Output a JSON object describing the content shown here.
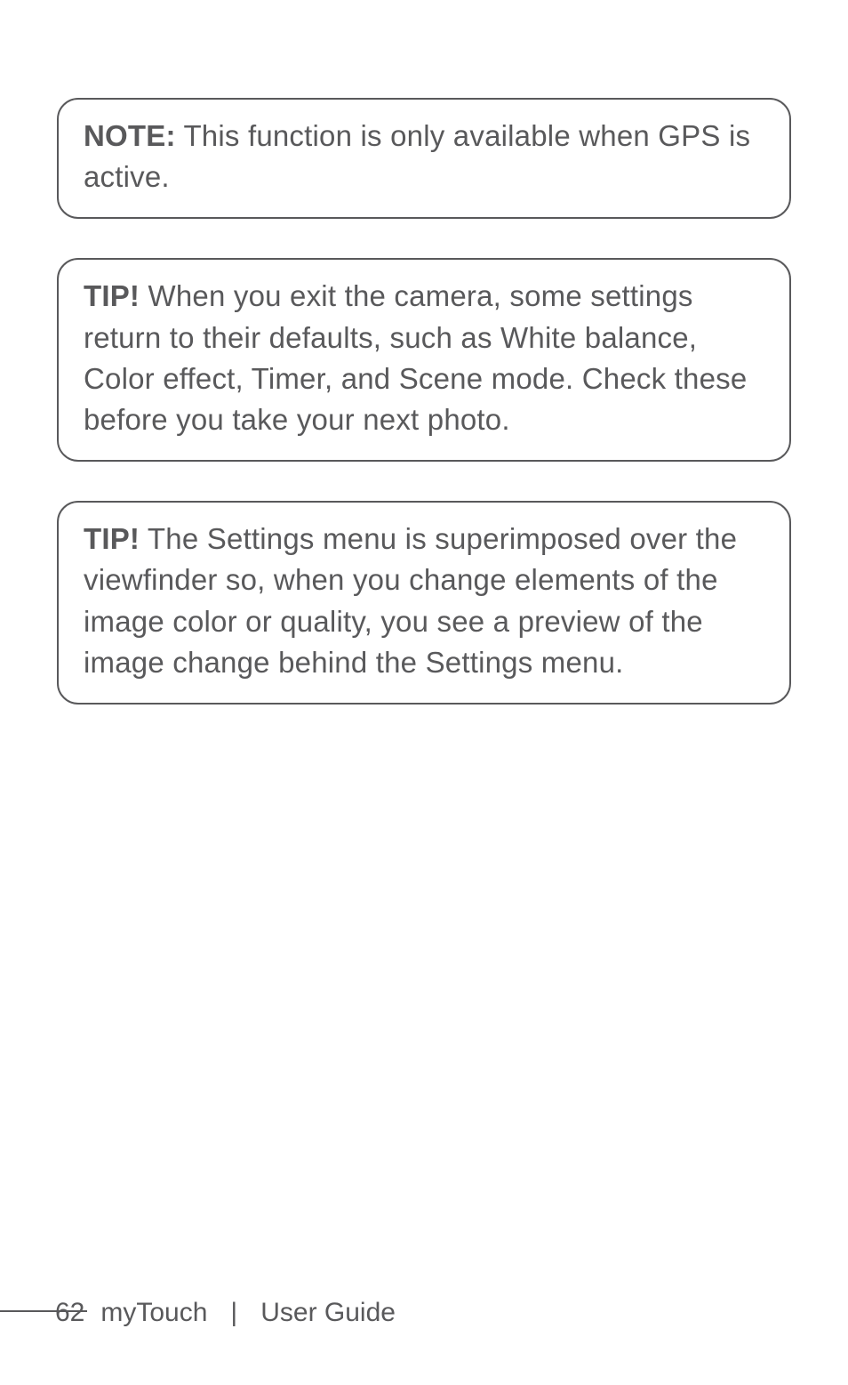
{
  "boxes": [
    {
      "lead": "NOTE:",
      "body": " This function is only available when GPS is active."
    },
    {
      "lead": "TIP!",
      "body": " When you exit the camera, some settings return to their defaults, such as White balance, Color effect, Timer, and Scene mode. Check these before you take your next photo."
    },
    {
      "lead": "TIP!",
      "body": " The Settings menu is superimposed over the viewfinder so, when you change elements of the image color or quality, you see a preview of the image change behind the Settings menu."
    }
  ],
  "footer": {
    "page": "62",
    "product": "myTouch",
    "sep": "|",
    "doc": "User Guide"
  }
}
